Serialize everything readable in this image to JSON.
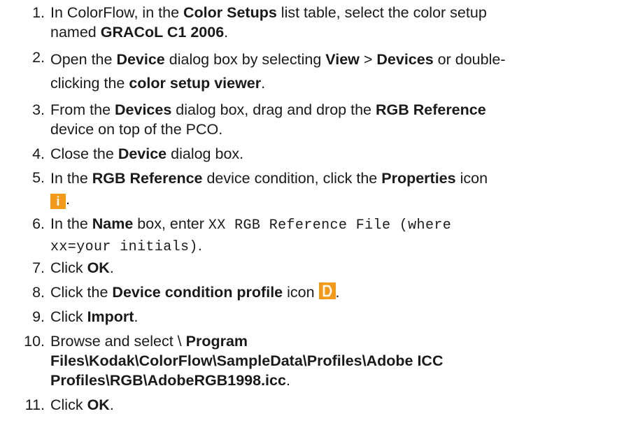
{
  "steps": [
    {
      "num": "1.",
      "l1a": "In ColorFlow, in the ",
      "l1b": "Color Setups",
      "l1c": " list table, select the color setup",
      "l2a": "named ",
      "l2b": "GRACoL C1 2006",
      "l2c": "."
    },
    {
      "num": "2.",
      "l1a": "Open the ",
      "l1b": "Device",
      "l1c": " dialog box by selecting ",
      "l1d": "View",
      "l1e": " > ",
      "l1f": "Devices",
      "l1g": " or double-",
      "l2a": "clicking the ",
      "l2b": "color setup viewer",
      "l2c": "."
    },
    {
      "num": "3.",
      "l1a": "From the ",
      "l1b": "Devices",
      "l1c": " dialog box, drag and drop the ",
      "l1d": "RGB Reference",
      "l2a": "device on top of the PCO."
    },
    {
      "num": "4.",
      "l1a": "Close the ",
      "l1b": "Device",
      "l1c": " dialog box."
    },
    {
      "num": "5.",
      "l1a": "In the ",
      "l1b": "RGB Reference",
      "l1c": " device condition, click the ",
      "l1d": "Properties",
      "l1e": " icon",
      "icon": "i",
      "l2a": "."
    },
    {
      "num": "6.",
      "l1a": "In the ",
      "l1b": "Name",
      "l1c": " box, enter ",
      "l1d": "XX RGB Reference File (where",
      "l2a": "xx=your initials)",
      "l2b": "."
    },
    {
      "num": "7.",
      "l1a": "Click ",
      "l1b": "OK",
      "l1c": "."
    },
    {
      "num": "8.",
      "l1a": "Click the ",
      "l1b": "Device condition profile",
      "l1c": " icon",
      "l1d": "."
    },
    {
      "num": "9.",
      "l1a": "Click ",
      "l1b": "Import",
      "l1c": "."
    },
    {
      "num": "10.",
      "l1a": "Browse and select \\ ",
      "l1b": "Program",
      "l2a": "Files\\Kodak\\ColorFlow\\SampleData\\Profiles\\Adobe ICC",
      "l3a": "Profiles\\RGB\\AdobeRGB1998.icc",
      "l3b": "."
    },
    {
      "num": "11.",
      "l1a": "Click ",
      "l1b": "OK",
      "l1c": "."
    }
  ],
  "colors": {
    "icon_orange": "#f39a1b",
    "text": "#1a1a1a"
  },
  "icons": [
    "info-icon",
    "device-condition-profile-icon"
  ]
}
